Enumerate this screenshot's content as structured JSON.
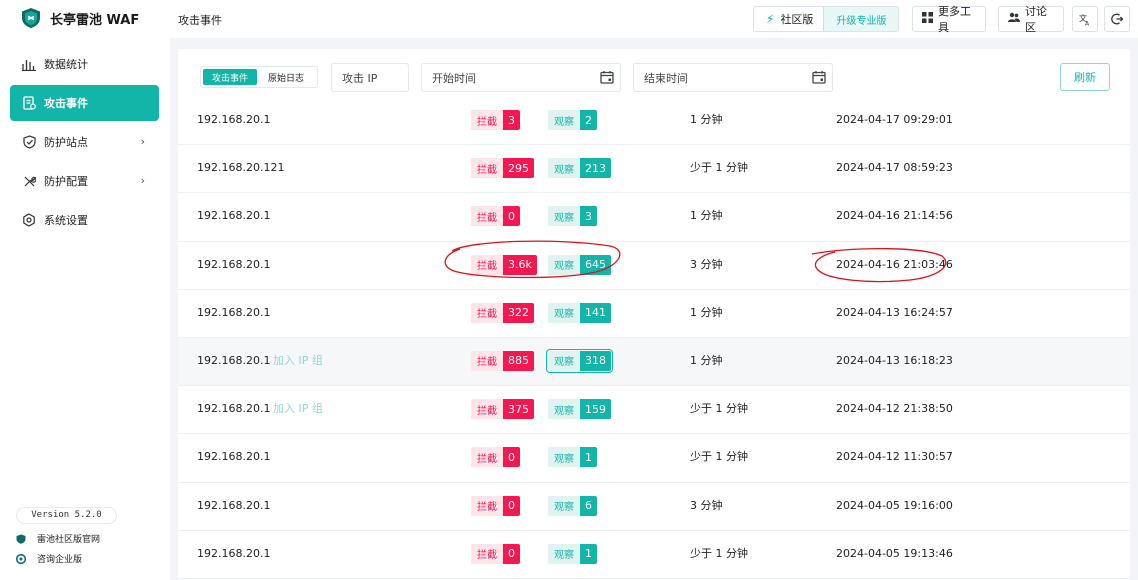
{
  "app": {
    "name": "长亭雷池 WAF"
  },
  "header": {
    "page_title": "攻击事件",
    "edition_label": "社区版",
    "upgrade_label": "升级专业版",
    "tools_label": "更多工具",
    "forum_label": "讨论区"
  },
  "sidebar": {
    "items": [
      {
        "label": "数据统计",
        "icon": "bar-chart-icon"
      },
      {
        "label": "攻击事件",
        "icon": "event-list-icon",
        "active": true
      },
      {
        "label": "防护站点",
        "icon": "shield-icon"
      },
      {
        "label": "防护配置",
        "icon": "tools-icon"
      },
      {
        "label": "系统设置",
        "icon": "gear-icon"
      }
    ],
    "version": "Version 5.2.0",
    "footer_links": [
      {
        "label": "雷池社区版官网",
        "icon": "shield-logo-icon"
      },
      {
        "label": "咨询企业版",
        "icon": "chat-icon"
      }
    ]
  },
  "filters": {
    "tabs": [
      "攻击事件",
      "原始日志"
    ],
    "ip_placeholder": "攻击 IP",
    "start_placeholder": "开始时间",
    "end_placeholder": "结束时间",
    "refresh_label": "刷新"
  },
  "labels": {
    "block": "拦截",
    "watch": "观察",
    "add_ip_group": "加入 IP 组"
  },
  "events": [
    {
      "ip": "192.168.20.1",
      "blocked": "3",
      "watched": "2",
      "duration": "1 分钟",
      "time": "2024-04-17 09:29:01"
    },
    {
      "ip": "192.168.20.121",
      "blocked": "295",
      "watched": "213",
      "duration": "少于 1 分钟",
      "time": "2024-04-17 08:59:23"
    },
    {
      "ip": "192.168.20.1",
      "blocked": "0",
      "watched": "3",
      "duration": "1 分钟",
      "time": "2024-04-16 21:14:56"
    },
    {
      "ip": "192.168.20.1",
      "blocked": "3.6k",
      "watched": "645",
      "duration": "3 分钟",
      "time": "2024-04-16 21:03:46"
    },
    {
      "ip": "192.168.20.1",
      "blocked": "322",
      "watched": "141",
      "duration": "1 分钟",
      "time": "2024-04-13 16:24:57"
    },
    {
      "ip": "192.168.20.1",
      "blocked": "885",
      "watched": "318",
      "duration": "1 分钟",
      "time": "2024-04-13 16:18:23"
    },
    {
      "ip": "192.168.20.1",
      "blocked": "375",
      "watched": "159",
      "duration": "少于 1 分钟",
      "time": "2024-04-12 21:38:50"
    },
    {
      "ip": "192.168.20.1",
      "blocked": "0",
      "watched": "1",
      "duration": "少于 1 分钟",
      "time": "2024-04-12 11:30:57"
    },
    {
      "ip": "192.168.20.1",
      "blocked": "0",
      "watched": "6",
      "duration": "3 分钟",
      "time": "2024-04-05 19:16:00"
    },
    {
      "ip": "192.168.20.1",
      "blocked": "0",
      "watched": "1",
      "duration": "少于 1 分钟",
      "time": "2024-04-05 19:13:46"
    }
  ],
  "colors": {
    "accent": "#12b5a8",
    "block": "#f5174f",
    "annotation": "#d9141b"
  }
}
